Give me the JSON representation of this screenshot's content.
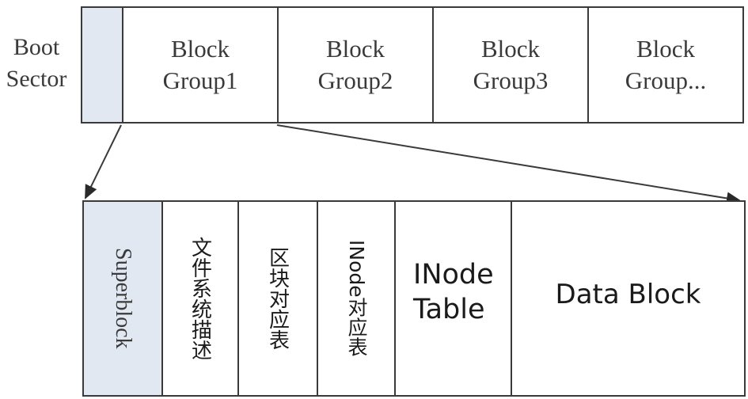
{
  "boot_sector": {
    "line1": "Boot",
    "line2": "Sector"
  },
  "top_blocks": [
    {
      "line1": "Block",
      "line2": "Group1"
    },
    {
      "line1": "Block",
      "line2": "Group2"
    },
    {
      "line1": "Block",
      "line2": "Group3"
    },
    {
      "line1": "Block",
      "line2": "Group..."
    }
  ],
  "detail_blocks": {
    "superblock": "Superblock",
    "fs_descriptor": "文件系统描述",
    "block_bitmap": "区块对应表",
    "inode_bitmap": "INode对应表",
    "inode_table_line1": "INode",
    "inode_table_line2": "Table",
    "data_block": "Data Block"
  },
  "colors": {
    "line": "#3a3a3a",
    "shade": "#e2e8f2"
  }
}
